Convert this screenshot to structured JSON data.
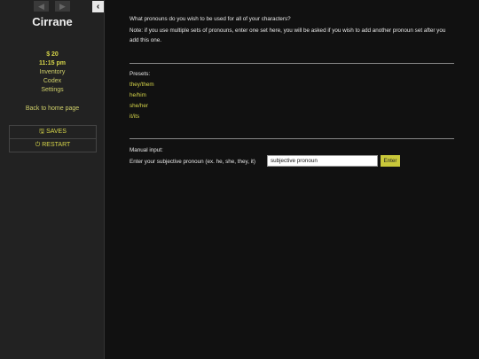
{
  "sidebar": {
    "history_back_icon": "arrow-left-icon",
    "history_forward_icon": "arrow-right-icon",
    "collapse_icon": "chevron-left-icon",
    "title": "Cirrane",
    "money": "$ 20",
    "time": "11:15 pm",
    "links": [
      "Inventory",
      "Codex",
      "Settings"
    ],
    "back_home": "Back to home page",
    "menu": {
      "saves": "SAVES",
      "restart": "RESTART"
    }
  },
  "main": {
    "question": "What pronouns do you wish to be used for all of your characters?",
    "note": "Note: if you use multiple sets of pronouns, enter one set here, you will be asked if you wish to add another pronoun set after you add this one.",
    "presets_label": "Presets:",
    "presets": [
      "they/them",
      "he/him",
      "she/her",
      "it/its"
    ],
    "manual_label": "Manual input:",
    "prompt": "Enter your subjective pronoun (ex. he, she, they, it)",
    "input_value": "subjective pronoun",
    "enter_label": "Enter"
  },
  "colors": {
    "accent": "#d7d64a",
    "sidebar_bg": "#222222",
    "main_bg": "#111111"
  }
}
